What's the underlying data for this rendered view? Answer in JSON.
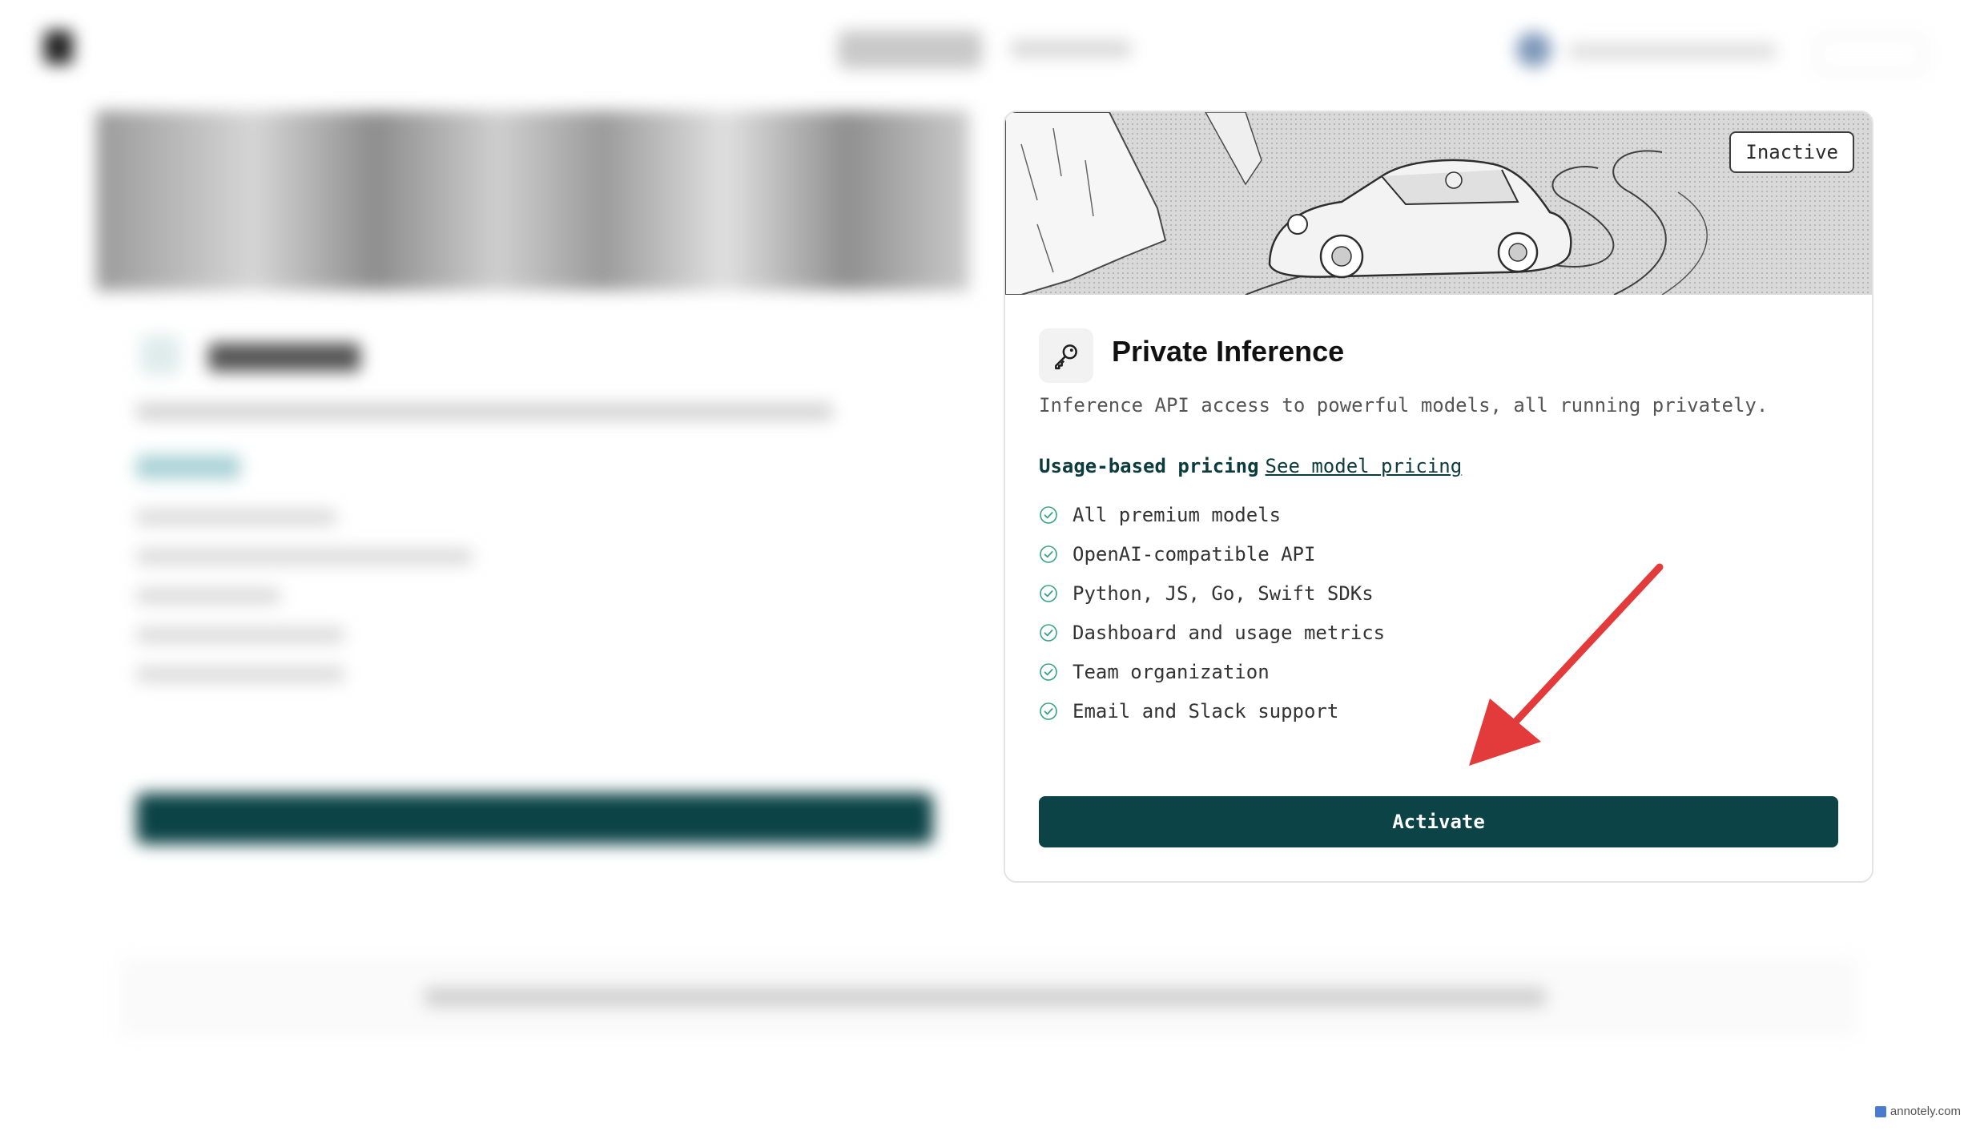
{
  "product": {
    "status_badge": "Inactive",
    "title": "Private Inference",
    "description": "Inference API access to powerful models, all running privately.",
    "pricing_label": "Usage-based pricing",
    "pricing_link": "See model pricing",
    "features": [
      "All premium models",
      "OpenAI-compatible API",
      "Python, JS, Go, Swift SDKs",
      "Dashboard and usage metrics",
      "Team organization",
      "Email and Slack support"
    ],
    "activate_label": "Activate"
  },
  "icons": {
    "product": "key-icon",
    "feature_check": "check-circle-icon",
    "annotation": "red-arrow-icon"
  },
  "colors": {
    "primary": "#0b4346",
    "check": "#3aa383",
    "arrow": "#e33b3b"
  },
  "watermark": "annotely.com"
}
